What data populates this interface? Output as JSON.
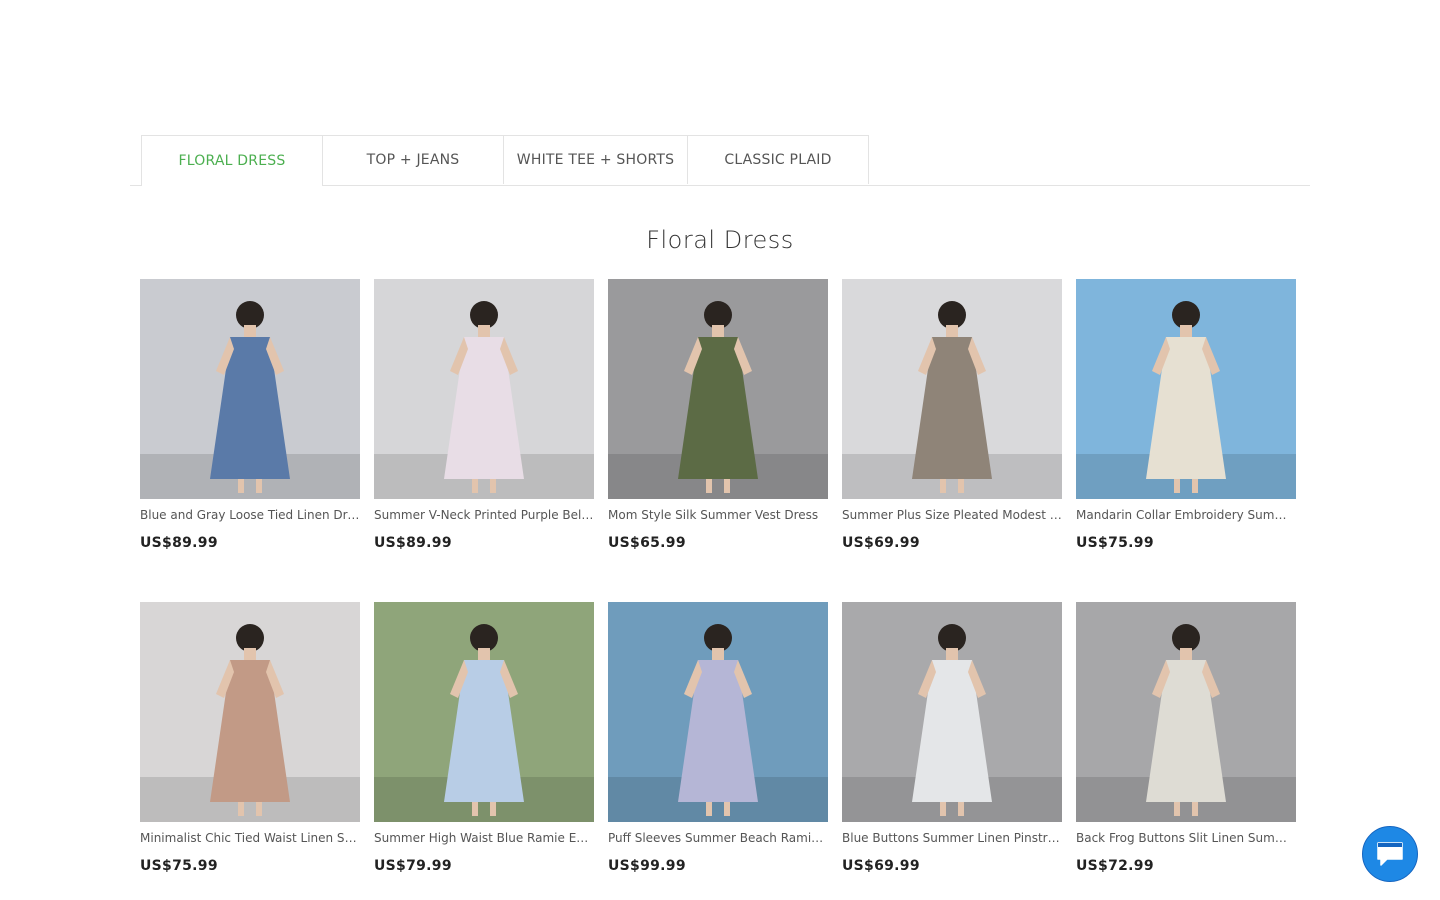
{
  "tabs": [
    {
      "label": "FLORAL DRESS",
      "active": true
    },
    {
      "label": "TOP + JEANS",
      "active": false
    },
    {
      "label": "WHITE TEE + SHORTS",
      "active": false
    },
    {
      "label": "CLASSIC PLAID",
      "active": false
    }
  ],
  "section": {
    "title": "Floral Dress"
  },
  "products": [
    {
      "name": "Blue and Gray Loose Tied Linen Dress",
      "price": "US$89.99",
      "bg": "#c9cbd0",
      "dress": "#5a7aa8"
    },
    {
      "name": "Summer V-Neck Printed Purple Belted Dress",
      "price": "US$89.99",
      "bg": "#d6d6d8",
      "dress": "#e8dde6"
    },
    {
      "name": "Mom Style Silk Summer Vest Dress",
      "price": "US$65.99",
      "bg": "#9a9a9c",
      "dress": "#5c6b45"
    },
    {
      "name": "Summer Plus Size Pleated Modest Dress",
      "price": "US$69.99",
      "bg": "#d9d9db",
      "dress": "#8f8478"
    },
    {
      "name": "Mandarin Collar Embroidery Summer Dress",
      "price": "US$75.99",
      "bg": "#7fb5dc",
      "dress": "#e6e0d2"
    },
    {
      "name": "Minimalist Chic Tied Waist Linen Summer Dress",
      "price": "US$75.99",
      "bg": "#d8d6d6",
      "dress": "#c29a86"
    },
    {
      "name": "Summer High Waist Blue Ramie Embroidery Dress",
      "price": "US$79.99",
      "bg": "#8fa57a",
      "dress": "#b8cde6"
    },
    {
      "name": "Puff Sleeves Summer Beach Ramie Dress",
      "price": "US$99.99",
      "bg": "#6f9cbc",
      "dress": "#b5b6d6"
    },
    {
      "name": "Blue Buttons Summer Linen Pinstripe Dress",
      "price": "US$69.99",
      "bg": "#a9a9ab",
      "dress": "#e4e6e8"
    },
    {
      "name": "Back Frog Buttons Slit Linen Summer Dress",
      "price": "US$72.99",
      "bg": "#a7a7a9",
      "dress": "#dedcd4"
    }
  ],
  "chat": {
    "icon": "chat-bubble-icon",
    "color": "#1e88e5"
  }
}
